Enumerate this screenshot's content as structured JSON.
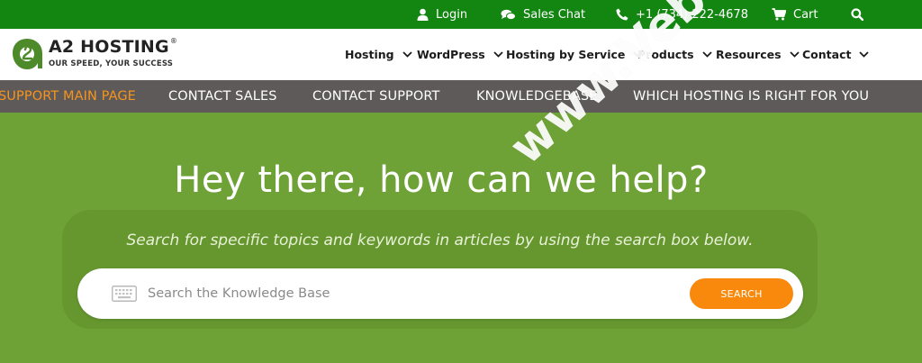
{
  "topbar": {
    "login": "Login",
    "sales_chat": "Sales Chat",
    "phone": "+1 (734) 222-4678",
    "cart": "Cart"
  },
  "logo": {
    "brand": "A2 HOSTING",
    "registered": "®",
    "tagline": "OUR SPEED, YOUR SUCCESS"
  },
  "mainnav": [
    "Hosting",
    "WordPress",
    "Hosting by Service",
    "Products",
    "Resources",
    "Contact"
  ],
  "subnav": [
    "SUPPORT MAIN PAGE",
    "CONTACT SALES",
    "CONTACT SUPPORT",
    "KNOWLEDGEBASE",
    "WHICH HOSTING IS RIGHT FOR YOU"
  ],
  "hero": {
    "title": "Hey there, how can we help?",
    "hint": "Search for specific topics and keywords in articles by using the search box below.",
    "search_placeholder": "Search the Knowledge Base",
    "search_button": "SEARCH"
  },
  "watermark": "www.Vebdc.com",
  "colors": {
    "topbar": "#128611",
    "subnav": "#5d5a59",
    "hero": "#6ea237",
    "accent_orange": "#f8890c"
  }
}
